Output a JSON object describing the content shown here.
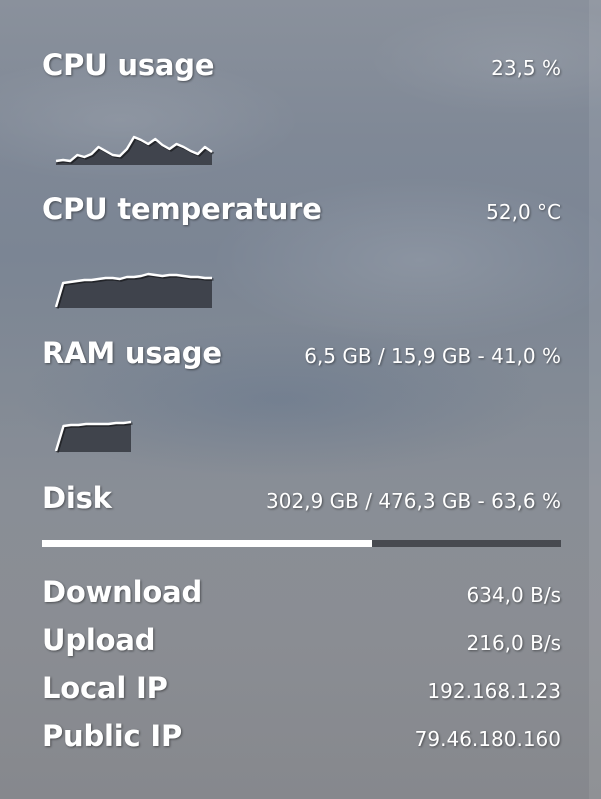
{
  "cpu": {
    "label": "CPU usage",
    "value": "23,5 %",
    "history": [
      4,
      5,
      4,
      10,
      8,
      11,
      18,
      14,
      10,
      9,
      16,
      28,
      25,
      21,
      26,
      20,
      16,
      21,
      18,
      14,
      11,
      18,
      13
    ]
  },
  "temperature": {
    "label": "CPU temperature",
    "value": "52,0 °C",
    "history": [
      1,
      25,
      26,
      27,
      28,
      28,
      29,
      30,
      30,
      29,
      31,
      31,
      32,
      34,
      33,
      32,
      33,
      33,
      32,
      31,
      31,
      30,
      30
    ]
  },
  "ram": {
    "label": "RAM usage",
    "value": "6,5 GB / 15,9 GB - 41,0 %",
    "history": [
      1,
      26,
      27,
      27,
      28,
      28,
      28,
      28,
      29,
      29,
      30
    ]
  },
  "disk": {
    "label": "Disk",
    "value": "302,9 GB / 476,3 GB - 63,6 %",
    "percent": 63.6
  },
  "network": {
    "download_label": "Download",
    "download_value": "634,0 B/s",
    "upload_label": "Upload",
    "upload_value": "216,0 B/s",
    "local_ip_label": "Local IP",
    "local_ip_value": "192.168.1.23",
    "public_ip_label": "Public IP",
    "public_ip_value": "79.46.180.160"
  },
  "colors": {
    "text": "#ffffff",
    "graph_fill": "#373a42",
    "graph_line": "#ffffff"
  }
}
